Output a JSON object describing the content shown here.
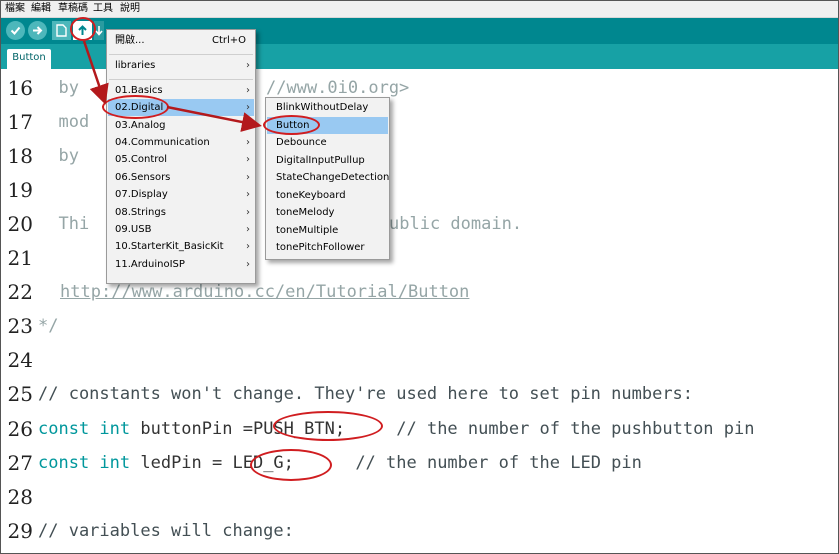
{
  "menubar": {
    "file": "檔案",
    "edit": "編輯",
    "sketch": "草稿碼",
    "tools": "工具",
    "help": "說明"
  },
  "toolbar": {
    "verify_icon": "check-icon",
    "upload_icon": "arrow-right-icon",
    "new_icon": "new-file-icon",
    "open_icon": "arrow-up-icon",
    "save_icon": "arrow-down-icon"
  },
  "tab": {
    "label": "Button"
  },
  "editor": {
    "lines": [
      {
        "n": "16",
        "text": "  by "
      },
      {
        "n": "17",
        "text": "  mod"
      },
      {
        "n": "18",
        "text": "  by "
      },
      {
        "n": "19",
        "text": ""
      },
      {
        "n": "20",
        "text": "  Thi"
      },
      {
        "n": "21",
        "text": ""
      },
      {
        "n": "22",
        "text": "http://www.arduino.cc/en/Tutorial/Button"
      },
      {
        "n": "23",
        "text": "*/"
      },
      {
        "n": "24",
        "text": ""
      },
      {
        "n": "25",
        "text": "// constants won't change. They're used here to set pin numbers:"
      },
      {
        "n": "26",
        "kw": "const int",
        "name": " buttonPin =",
        "val": "PUSH_BTN;",
        "comment": "     // the number of the pushbutton pin"
      },
      {
        "n": "27",
        "kw": "const int",
        "name": " ledPin = ",
        "val": "LED_G;",
        "comment": "      // the number of the LED pin"
      },
      {
        "n": "28",
        "text": ""
      },
      {
        "n": "29",
        "text": "// variables will change:"
      }
    ],
    "peek_16": "//www.0i0.org>",
    "peek_20": "ublic domain."
  },
  "menu_open": {
    "items": [
      {
        "label": "開啟...",
        "shortcut": "Ctrl+O"
      },
      {
        "label": "libraries"
      },
      {
        "label": "01.Basics"
      },
      {
        "label": "02.Digital"
      },
      {
        "label": "03.Analog"
      },
      {
        "label": "04.Communication"
      },
      {
        "label": "05.Control"
      },
      {
        "label": "06.Sensors"
      },
      {
        "label": "07.Display"
      },
      {
        "label": "08.Strings"
      },
      {
        "label": "09.USB"
      },
      {
        "label": "10.StarterKit_BasicKit"
      },
      {
        "label": "11.ArduinoISP"
      }
    ]
  },
  "submenu_digital": {
    "items": [
      "BlinkWithoutDelay",
      "Button",
      "Debounce",
      "DigitalInputPullup",
      "StateChangeDetection",
      "toneKeyboard",
      "toneMelody",
      "toneMultiple",
      "tonePitchFollower"
    ]
  },
  "colors": {
    "toolbar": "#00878f",
    "tabstrip": "#17a1a5",
    "keyword": "#00979c",
    "annotation": "#d01d20",
    "highlight": "#99c9f2"
  }
}
